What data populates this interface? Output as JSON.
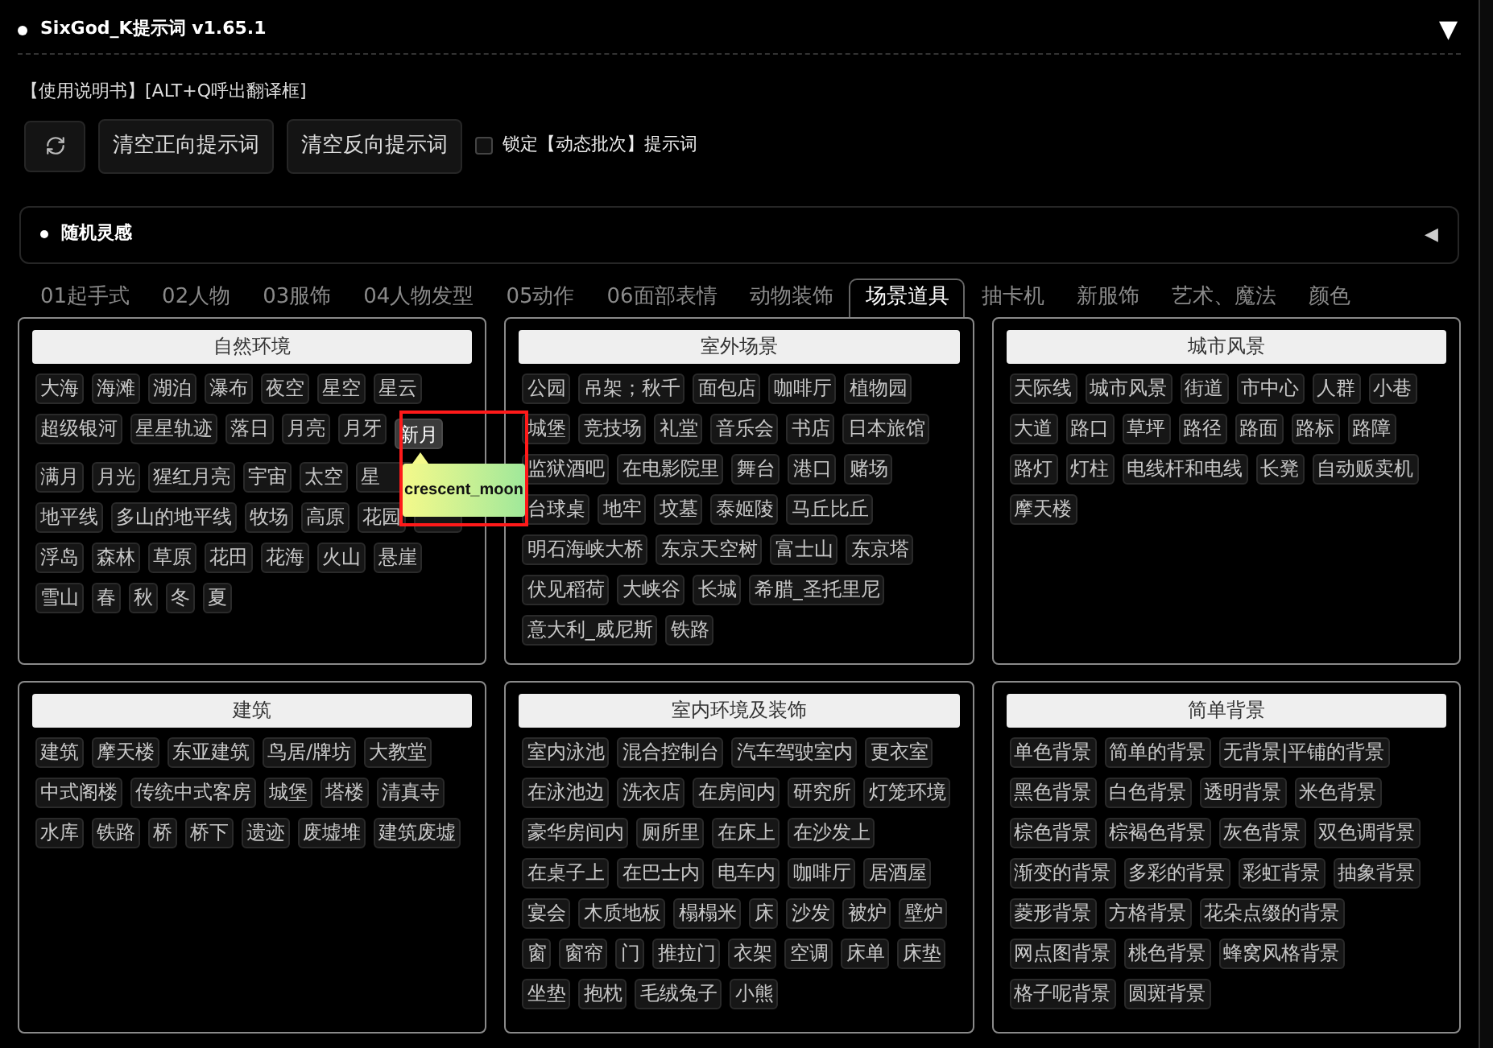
{
  "header": {
    "title": "SixGod_K提示词 v1.65.1",
    "toggle": "▼"
  },
  "help": "【使用说明书】[ALT+Q呼出翻译框]",
  "buttons": [
    "清空正向提示词",
    "清空反向提示词"
  ],
  "lock": {
    "label": "锁定【动态批次】提示词",
    "checked": false
  },
  "inspiration": {
    "title": "随机灵感",
    "toggle": "◀"
  },
  "tabs": [
    {
      "label": "01起手式",
      "selected": false
    },
    {
      "label": "02人物",
      "selected": false
    },
    {
      "label": "03服饰",
      "selected": false
    },
    {
      "label": "04人物发型",
      "selected": false
    },
    {
      "label": "05动作",
      "selected": false
    },
    {
      "label": "06面部表情",
      "selected": false
    },
    {
      "label": "动物装饰",
      "selected": false
    },
    {
      "label": "场景道具",
      "selected": true
    },
    {
      "label": "抽卡机",
      "selected": false
    },
    {
      "label": "新服饰",
      "selected": false
    },
    {
      "label": "艺术、魔法",
      "selected": false
    },
    {
      "label": "颜色",
      "selected": false
    }
  ],
  "panels": [
    {
      "title": "自然环境",
      "tags": [
        "大海",
        "海滩",
        "湖泊",
        "瀑布",
        "夜空",
        "星空",
        "星云",
        "超级银河",
        "星星轨迹",
        "落日",
        "月亮",
        "月牙",
        {
          "label": "新月",
          "tooltip": "crescent_moon"
        },
        "满月",
        "月光",
        "猩红月亮",
        "宇宙",
        "太空",
        {
          "label": "星",
          "cut": true
        },
        "地平线",
        "多山的地平线",
        "牧场",
        "高原",
        "花园",
        {
          "covered": true
        },
        "浮岛",
        "森林",
        "草原",
        "花田",
        "花海",
        "火山",
        "悬崖",
        "雪山",
        "春",
        "秋",
        "冬",
        "夏"
      ]
    },
    {
      "title": "室外场景",
      "tags": [
        "公园",
        "吊架；秋千",
        "面包店",
        "咖啡厅",
        "植物园",
        "城堡",
        "竞技场",
        "礼堂",
        "音乐会",
        "书店",
        "日本旅馆",
        "监狱酒吧",
        "在电影院里",
        "舞台",
        "港口",
        "赌场",
        "台球桌",
        "地牢",
        "坟墓",
        "泰姬陵",
        "马丘比丘",
        "明石海峡大桥",
        "东京天空树",
        "富士山",
        "东京塔",
        "伏见稻荷",
        "大峡谷",
        "长城",
        "希腊_圣托里尼",
        "意大利_威尼斯",
        "铁路"
      ]
    },
    {
      "title": "城市风景",
      "tags": [
        "天际线",
        "城市风景",
        "街道",
        "市中心",
        "人群",
        "小巷",
        "大道",
        "路口",
        "草坪",
        "路径",
        "路面",
        "路标",
        "路障",
        "路灯",
        "灯柱",
        "电线杆和电线",
        "长凳",
        "自动贩卖机",
        "摩天楼"
      ]
    },
    {
      "title": "建筑",
      "tags": [
        "建筑",
        "摩天楼",
        "东亚建筑",
        "鸟居/牌坊",
        "大教堂",
        "中式阁楼",
        "传统中式客房",
        "城堡",
        "塔楼",
        "清真寺",
        "水库",
        "铁路",
        "桥",
        "桥下",
        "遗迹",
        "废墟堆",
        "建筑废墟"
      ]
    },
    {
      "title": "室内环境及装饰",
      "tags": [
        "室内泳池",
        "混合控制台",
        "汽车驾驶室内",
        "更衣室",
        "在泳池边",
        "洗衣店",
        "在房间内",
        "研究所",
        "灯笼环境",
        "豪华房间内",
        "厕所里",
        "在床上",
        "在沙发上",
        "在桌子上",
        "在巴士内",
        "电车内",
        "咖啡厅",
        "居酒屋",
        "宴会",
        "木质地板",
        "榻榻米",
        "床",
        "沙发",
        "被炉",
        "壁炉",
        "窗",
        "窗帘",
        "门",
        "推拉门",
        "衣架",
        "空调",
        "床单",
        "床垫",
        "坐垫",
        "抱枕",
        "毛绒兔子",
        "小熊"
      ]
    },
    {
      "title": "简单背景",
      "tags": [
        "单色背景",
        "简单的背景",
        "无背景|平铺的背景",
        "黑色背景",
        "白色背景",
        "透明背景",
        "米色背景",
        "棕色背景",
        "棕褐色背景",
        "灰色背景",
        "双色调背景",
        "渐变的背景",
        "多彩的背景",
        "彩虹背景",
        "抽象背景",
        "菱形背景",
        "方格背景",
        "花朵点缀的背景",
        "网点图背景",
        "桃色背景",
        "蜂窝风格背景",
        "格子呢背景",
        "圆斑背景"
      ]
    }
  ]
}
